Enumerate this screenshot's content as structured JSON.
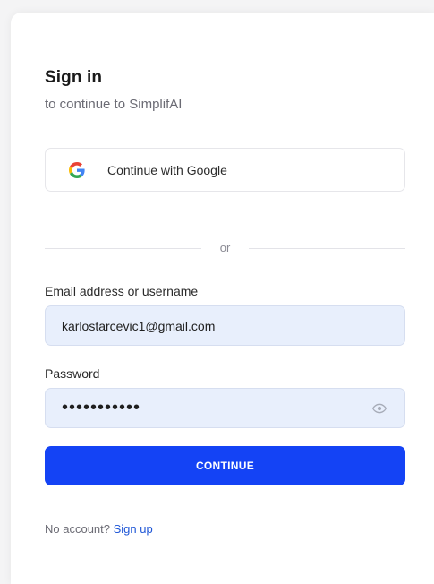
{
  "signin": {
    "title": "Sign in",
    "subtitle": "to continue to SimplifAI",
    "google_button_label": "Continue with Google",
    "divider_text": "or",
    "email_label": "Email address or username",
    "email_value": "karlostarcevic1@gmail.com",
    "password_label": "Password",
    "password_mask": "•••••••••••",
    "continue_label": "CONTINUE",
    "no_account_text": "No account?",
    "signup_link": "Sign up"
  },
  "icons": {
    "google": "google-logo-icon",
    "password_toggle": "eye-icon"
  },
  "colors": {
    "accent": "#1443f5",
    "link": "#1e56d6",
    "input_background": "#e8effc"
  }
}
